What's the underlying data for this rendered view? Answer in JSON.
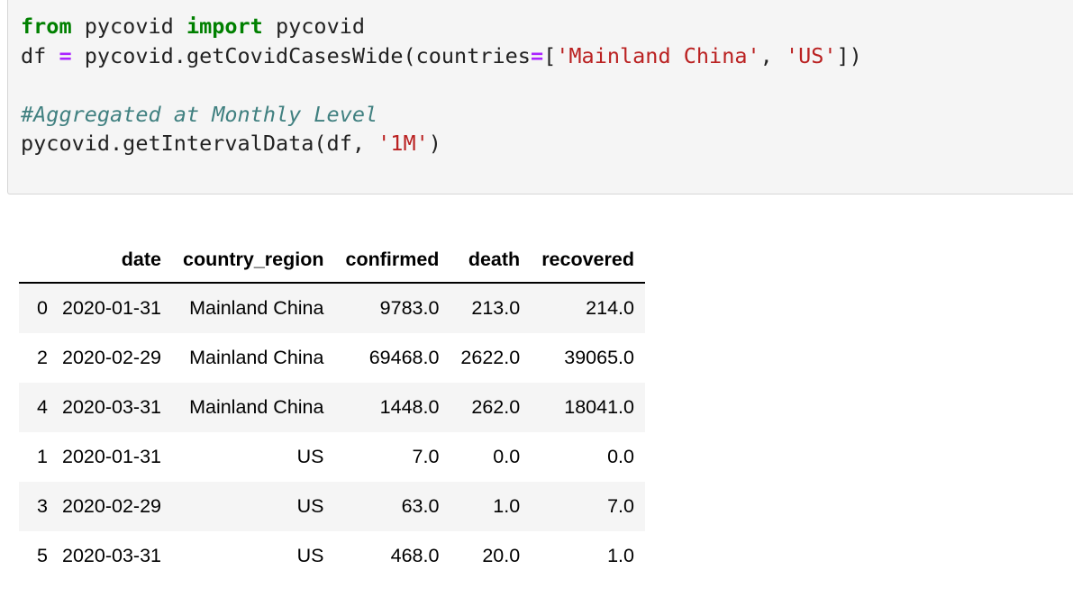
{
  "code_cell": {
    "lines": [
      [
        {
          "t": "from",
          "c": "kw"
        },
        {
          "t": " pycovid ",
          "c": ""
        },
        {
          "t": "import",
          "c": "kw"
        },
        {
          "t": " pycovid",
          "c": ""
        }
      ],
      [
        {
          "t": "df ",
          "c": ""
        },
        {
          "t": "=",
          "c": "op"
        },
        {
          "t": " pycovid.getCovidCasesWide(countries",
          "c": ""
        },
        {
          "t": "=",
          "c": "op"
        },
        {
          "t": "[",
          "c": ""
        },
        {
          "t": "'Mainland China'",
          "c": "str"
        },
        {
          "t": ", ",
          "c": ""
        },
        {
          "t": "'US'",
          "c": "str"
        },
        {
          "t": "])",
          "c": ""
        }
      ],
      [],
      [
        {
          "t": "#Aggregated at Monthly Level",
          "c": "cm"
        }
      ],
      [
        {
          "t": "pycovid.getIntervalData(df, ",
          "c": ""
        },
        {
          "t": "'1M'",
          "c": "str"
        },
        {
          "t": ")",
          "c": ""
        }
      ]
    ]
  },
  "output_table": {
    "columns": [
      "",
      "date",
      "country_region",
      "confirmed",
      "death",
      "recovered"
    ],
    "rows": [
      {
        "index": "0",
        "date": "2020-01-31",
        "country_region": "Mainland China",
        "confirmed": "9783.0",
        "death": "213.0",
        "recovered": "214.0"
      },
      {
        "index": "2",
        "date": "2020-02-29",
        "country_region": "Mainland China",
        "confirmed": "69468.0",
        "death": "2622.0",
        "recovered": "39065.0"
      },
      {
        "index": "4",
        "date": "2020-03-31",
        "country_region": "Mainland China",
        "confirmed": "1448.0",
        "death": "262.0",
        "recovered": "18041.0"
      },
      {
        "index": "1",
        "date": "2020-01-31",
        "country_region": "US",
        "confirmed": "7.0",
        "death": "0.0",
        "recovered": "0.0"
      },
      {
        "index": "3",
        "date": "2020-02-29",
        "country_region": "US",
        "confirmed": "63.0",
        "death": "1.0",
        "recovered": "7.0"
      },
      {
        "index": "5",
        "date": "2020-03-31",
        "country_region": "US",
        "confirmed": "468.0",
        "death": "20.0",
        "recovered": "1.0"
      }
    ]
  },
  "colors": {
    "keyword": "#008000",
    "operator": "#aa22ff",
    "string": "#ba2121",
    "comment": "#408080",
    "input_background": "#f5f5f5",
    "striped_row": "#f5f5f5"
  }
}
